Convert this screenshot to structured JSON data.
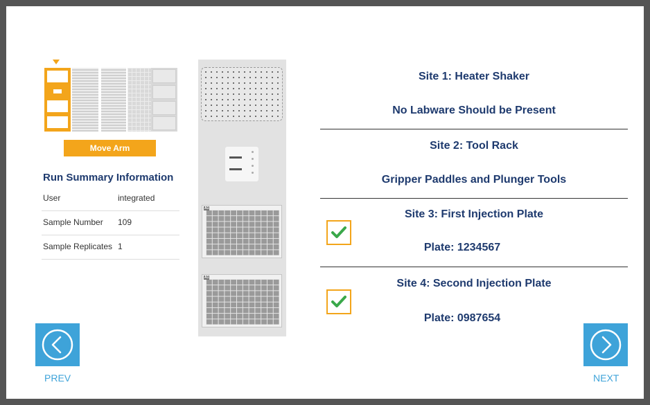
{
  "left_panel": {
    "move_arm_label": "Move Arm",
    "summary_title": "Run Summary Information",
    "summary_rows": [
      {
        "label": "User",
        "value": "integrated"
      },
      {
        "label": "Sample Number",
        "value": "109"
      },
      {
        "label": "Sample Replicates",
        "value": "1"
      }
    ]
  },
  "deck": {
    "plate_1_label": "A1",
    "plate_2_label": "A1"
  },
  "sites": {
    "site1_title": "Site 1: Heater Shaker",
    "site1_detail": "No Labware Should be Present",
    "site2_title": "Site 2: Tool Rack",
    "site2_detail": "Gripper Paddles and Plunger Tools",
    "site3_title": "Site 3: First Injection Plate",
    "site3_detail": "Plate: 1234567",
    "site3_checked": true,
    "site4_title": "Site 4: Second Injection Plate",
    "site4_detail": "Plate: 0987654",
    "site4_checked": true
  },
  "nav": {
    "prev_label": "PREV",
    "prev_icon": "chevron-left-circle-icon",
    "next_label": "NEXT",
    "next_icon": "chevron-right-circle-icon"
  },
  "colors": {
    "accent_orange": "#f3a51b",
    "nav_blue": "#3ea3d9",
    "heading_navy": "#1e3a6e",
    "check_green": "#3aa84a"
  }
}
